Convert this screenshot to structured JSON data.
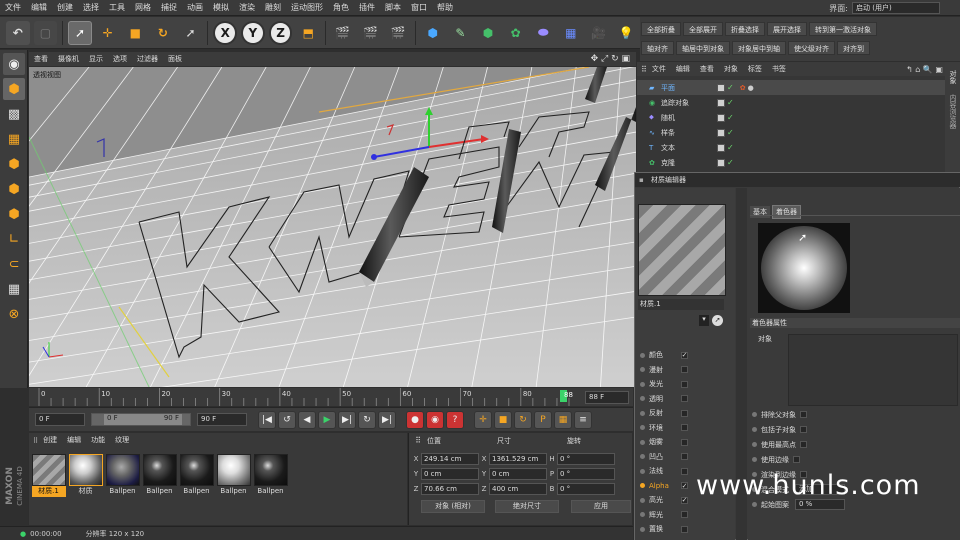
{
  "menubar": {
    "items": [
      "文件",
      "编辑",
      "创建",
      "选择",
      "工具",
      "网格",
      "捕捉",
      "动画",
      "模拟",
      "渲染",
      "雕刻",
      "运动图形",
      "角色",
      "插件",
      "脚本",
      "窗口",
      "帮助"
    ],
    "layout_label": "界面:",
    "layout_value": "启动 (用户)"
  },
  "right_strip": {
    "row1": [
      "全部折叠",
      "全部展开",
      "折叠选择",
      "展开选择",
      "转到第一激活对象"
    ],
    "row2": [
      "轴对齐",
      "轴居中到对象",
      "对象居中到轴",
      "使父级对齐",
      "对齐到"
    ]
  },
  "viewport": {
    "menu": [
      "查看",
      "摄像机",
      "显示",
      "选项",
      "过滤器",
      "面板"
    ],
    "label": "透视视图"
  },
  "timeline": {
    "ticks": [
      "0",
      "10",
      "20",
      "30",
      "40",
      "50",
      "60",
      "70",
      "80",
      "88"
    ],
    "end_frame": "88 F",
    "current": 88,
    "max": 88
  },
  "playback": {
    "start": "0 F",
    "range_start": "0 F",
    "range_end": "90 F",
    "end": "90 F"
  },
  "material_manager": {
    "menu": [
      "创建",
      "编辑",
      "功能",
      "纹理"
    ],
    "materials": [
      {
        "label": "材质.1",
        "style": "stripe"
      },
      {
        "label": "材质",
        "style": "white"
      },
      {
        "label": "Ballpen",
        "style": "stripe-dark"
      },
      {
        "label": "Ballpen",
        "style": "black"
      },
      {
        "label": "Ballpen",
        "style": "black"
      },
      {
        "label": "Ballpen",
        "style": "white"
      },
      {
        "label": "Ballpen",
        "style": "black"
      }
    ]
  },
  "coordinates": {
    "headers": [
      "位置",
      "尺寸",
      "旋转"
    ],
    "rows": [
      {
        "axis": "X",
        "pos": "249.14 cm",
        "size_axis": "X",
        "size": "1361.529 cm",
        "rot_axis": "H",
        "rot": "0 °"
      },
      {
        "axis": "Y",
        "pos": "0 cm",
        "size_axis": "Y",
        "size": "0 cm",
        "rot_axis": "P",
        "rot": "0 °"
      },
      {
        "axis": "Z",
        "pos": "70.66 cm",
        "size_axis": "Z",
        "size": "400 cm",
        "rot_axis": "B",
        "rot": "0 °"
      }
    ],
    "mode1": "对象 (相对)",
    "mode2": "绝对尺寸",
    "apply": "应用"
  },
  "status": {
    "time": "00:00:00",
    "message": "分辨率 120 x 120"
  },
  "logo": {
    "line1": "MAXON",
    "line2": "CINEMA 4D"
  },
  "object_manager": {
    "menu": [
      "文件",
      "编辑",
      "查看",
      "对象",
      "标签",
      "书签"
    ],
    "objects": [
      {
        "name": "平面",
        "color": "#6fb6ff"
      },
      {
        "name": "追踪对象",
        "color": "#dddddd"
      },
      {
        "name": "随机",
        "color": "#dddddd"
      },
      {
        "name": "样条",
        "color": "#dddddd"
      },
      {
        "name": "文本",
        "color": "#dddddd"
      },
      {
        "name": "克隆",
        "color": "#dddddd"
      }
    ],
    "side_tabs": [
      "对象",
      "内容浏览器"
    ]
  },
  "material_editor": {
    "title": "材质编辑器",
    "material_name": "材质.1",
    "channels": [
      {
        "name": "颜色",
        "checked": true
      },
      {
        "name": "漫射",
        "checked": false
      },
      {
        "name": "发光",
        "checked": false
      },
      {
        "name": "透明",
        "checked": false
      },
      {
        "name": "反射",
        "checked": false
      },
      {
        "name": "环境",
        "checked": false
      },
      {
        "name": "烟雾",
        "checked": false
      },
      {
        "name": "凹凸",
        "checked": false
      },
      {
        "name": "法线",
        "checked": false
      },
      {
        "name": "Alpha",
        "checked": true,
        "highlight": true
      },
      {
        "name": "高光",
        "checked": true
      },
      {
        "name": "辉光",
        "checked": false
      },
      {
        "name": "置换",
        "checked": false
      }
    ],
    "tabs": [
      "基本",
      "着色器"
    ],
    "shader_props_title": "着色器属性",
    "object_label": "对象",
    "options": [
      "排除父对象",
      "包括子对象",
      "使用最高点",
      "使用边缘",
      "渲染到边缘",
      "混合模式",
      "起始图案"
    ],
    "blend_value": "添加",
    "start_value": "0 %"
  },
  "watermark": "www.hunls.com"
}
